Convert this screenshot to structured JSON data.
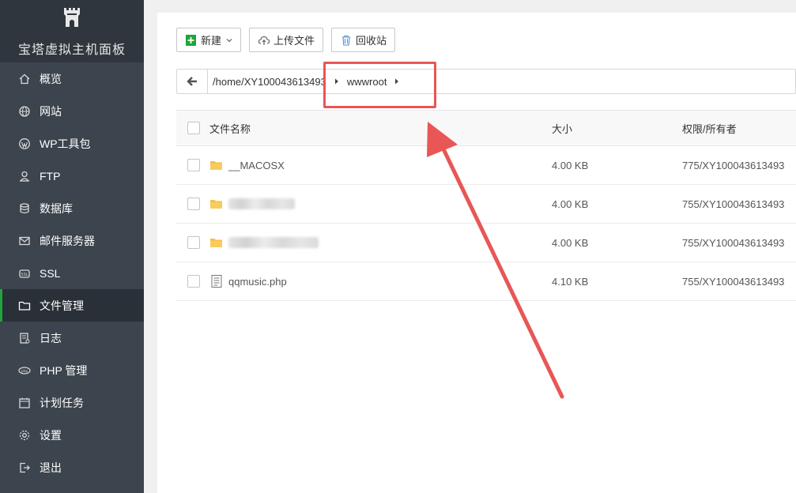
{
  "app": {
    "brand_name": "宝塔虚拟主机面板",
    "logo_icon": "bt-castle-logo"
  },
  "sidebar": {
    "items": [
      {
        "label": "概览",
        "icon": "home-icon"
      },
      {
        "label": "网站",
        "icon": "globe-icon"
      },
      {
        "label": "WP工具包",
        "icon": "wordpress-icon"
      },
      {
        "label": "FTP",
        "icon": "ftp-icon"
      },
      {
        "label": "数据库",
        "icon": "database-icon"
      },
      {
        "label": "邮件服务器",
        "icon": "mail-icon"
      },
      {
        "label": "SSL",
        "icon": "ssl-icon"
      },
      {
        "label": "文件管理",
        "icon": "folder-icon",
        "active": true
      },
      {
        "label": "日志",
        "icon": "log-icon"
      },
      {
        "label": "PHP 管理",
        "icon": "php-icon"
      },
      {
        "label": "计划任务",
        "icon": "calendar-icon"
      },
      {
        "label": "设置",
        "icon": "gear-icon"
      },
      {
        "label": "退出",
        "icon": "logout-icon"
      }
    ]
  },
  "toolbar": {
    "new_label": "新建",
    "upload_label": "上传文件",
    "recycle_label": "回收站"
  },
  "path": {
    "home": "/home/XY100043613493",
    "current": "wwwroot"
  },
  "table": {
    "headers": {
      "name": "文件名称",
      "size": "大小",
      "perm": "权限/所有者"
    },
    "rows": [
      {
        "name": "__MACOSX",
        "type": "folder",
        "size": "4.00 KB",
        "perm": "775/XY100043613493",
        "obscured": false
      },
      {
        "name": "",
        "type": "folder",
        "size": "4.00 KB",
        "perm": "755/XY100043613493",
        "obscured": true
      },
      {
        "name": "",
        "type": "folder",
        "size": "4.00 KB",
        "perm": "755/XY100043613493",
        "obscured": true
      },
      {
        "name": "qqmusic.php",
        "type": "file",
        "size": "4.10 KB",
        "perm": "755/XY100043613493",
        "obscured": false
      }
    ]
  },
  "colors": {
    "sidebar_bg": "#3c444d",
    "brand_bg": "#2f363d",
    "accent_green": "#20a53a",
    "annotation_red": "#e85656",
    "folder_yellow": "#f5c04a"
  }
}
